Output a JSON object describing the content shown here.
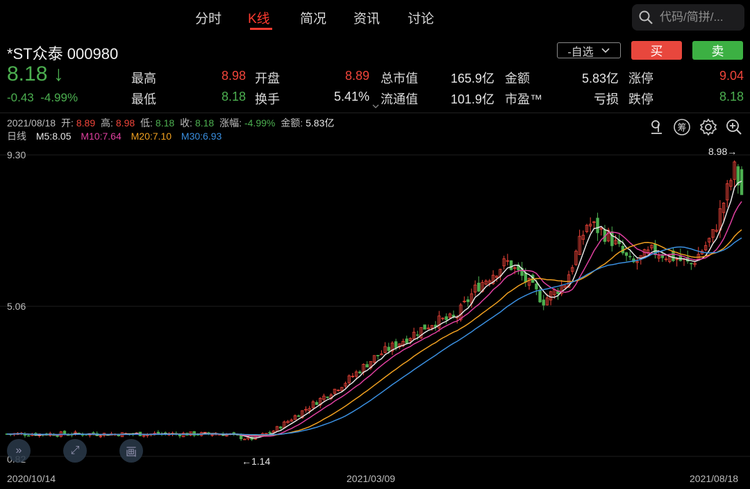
{
  "tabs": [
    "分时",
    "K线",
    "简况",
    "资讯",
    "讨论"
  ],
  "search": {
    "placeholder": "代码/简拼/..."
  },
  "stock": {
    "name": "*ST众泰 000980",
    "price": "8.18",
    "arrow": "↓",
    "change": "-0.43",
    "change_pct": "-4.99%"
  },
  "buttons": {
    "watchlist": "-自选",
    "buy": "买",
    "sell": "卖"
  },
  "quote": {
    "high_label": "最高",
    "high": "8.98",
    "low_label": "最低",
    "low": "8.18",
    "open_label": "开盘",
    "open": "8.89",
    "turnover_label": "换手",
    "turnover": "5.41%",
    "mktcap_label": "总市值",
    "mktcap": "165.9亿",
    "float_label": "流通值",
    "float": "101.9亿",
    "amount_label": "金额",
    "amount": "5.83亿",
    "pe_label": "市盈™",
    "pe": "亏损",
    "limit_up_label": "涨停",
    "limit_up": "9.04",
    "limit_down_label": "跌停",
    "limit_down": "8.18"
  },
  "info_bar": {
    "date": "2021/08/18",
    "open_label": "开:",
    "open": "8.89",
    "high_label": "高:",
    "high": "8.98",
    "low_label": "低:",
    "low": "8.18",
    "close_label": "收:",
    "close": "8.18",
    "chg_label": "涨幅:",
    "chg": "-4.99%",
    "amt_label": "金额:",
    "amt": "5.83亿"
  },
  "ma": {
    "period": "日线",
    "m5": "M5:8.05",
    "m10": "M10:7.64",
    "m20": "M20:7.10",
    "m30": "M30:6.93"
  },
  "colors": {
    "up": "#f0453a",
    "down": "#4caf50",
    "m5": "#e6e6e6",
    "m10": "#e040a0",
    "m20": "#f0a020",
    "m30": "#3a8fe0"
  },
  "icons": [
    "draw-line-icon",
    "chip-distribution-icon",
    "gear-icon",
    "zoom-in-icon"
  ],
  "chart": {
    "y_top": "9.30",
    "y_mid": "5.06",
    "y_bottom": "0.82",
    "max_label": "8.98→",
    "min_label": "←1.14",
    "dates": [
      "2020/10/14",
      "2021/03/09",
      "2021/08/18"
    ]
  },
  "chart_data": {
    "type": "candlestick",
    "ylim": [
      0.82,
      9.3
    ],
    "x_start": "2020/10/14",
    "x_end": "2021/08/18",
    "period_high": 8.98,
    "period_low": 1.14,
    "last": {
      "open": 8.89,
      "high": 8.98,
      "low": 8.18,
      "close": 8.18
    },
    "ma": {
      "M5": 8.05,
      "M10": 7.64,
      "M20": 7.1,
      "M30": 6.93
    }
  }
}
